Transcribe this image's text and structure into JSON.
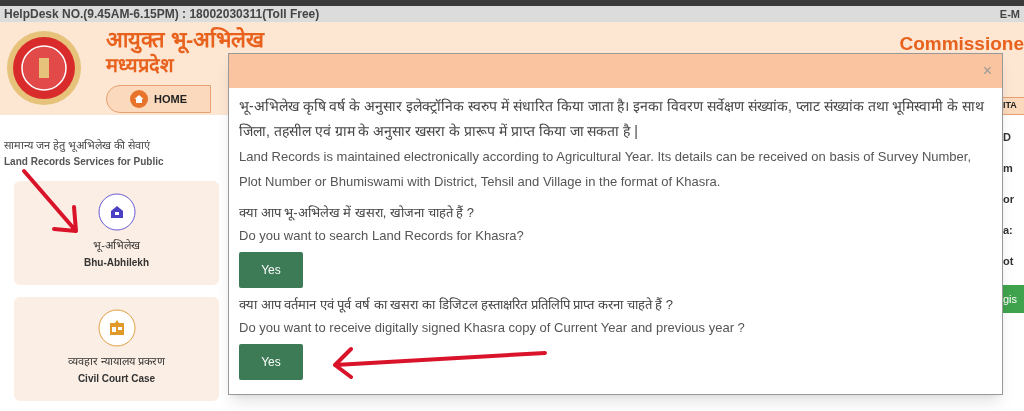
{
  "top_bar": {
    "helpdesk": "HelpDesk NO.(9.45AM-6.15PM) : 18002030311(Toll Free)",
    "email_label": "E-M"
  },
  "header": {
    "title_line_1": "आयुक्त भू-अभिलेख",
    "title_line_2": "मध्यप्रदेश",
    "title_english": "Commissione"
  },
  "nav": {
    "items": [
      {
        "label": "HOME",
        "kind": "home"
      },
      {
        "label": "ITA",
        "kind": "plain"
      }
    ]
  },
  "services": {
    "heading_hindi": "सामान्य जन हेतु भूअभिलेख की सेवाएं",
    "heading_english": "Land Records Services for Public",
    "cards": [
      {
        "title_hindi": "भू-अभिलेख",
        "title_english": "Bhu-Abhilekh",
        "kind": "house"
      },
      {
        "title_hindi": "व्यवहार न्यायालय प्रकरण",
        "title_english": "Civil Court Case",
        "kind": "court"
      }
    ]
  },
  "right_panel": {
    "fragments": [
      "D",
      "m",
      "or",
      "a:",
      "ot"
    ],
    "button": "gis"
  },
  "modal": {
    "close": "×",
    "intro_hindi": "भू-अभिलेख कृषि वर्ष के अनुसार इलेक्ट्रॉनिक स्वरुप में संधारित किया जाता है। इनका विवरण सर्वेक्षण संख्यांक, प्लाट संख्यांक तथा भूमिस्वामी के साथ जिला, तहसील एवं ग्राम के अनुसार खसरा के प्रारूप में प्राप्त किया जा सकता है |",
    "intro_english": "Land Records is maintained electronically according to Agricultural Year. Its details can be received on basis of Survey Number, Plot Number or Bhumiswami with District, Tehsil and Village in the format of Khasra.",
    "questions": [
      {
        "hindi": "क्या आप भू-अभिलेख में खसरा, खोजना चाहते हैं ?",
        "english": "Do you want to search Land Records for Khasra?",
        "button": "Yes"
      },
      {
        "hindi": "क्या आप वर्तमान एवं पूर्व वर्ष का खसरा का डिजिटल हस्ताक्षरित प्रतिलिपि प्राप्त करना चाहते हैं ?",
        "english": "Do you want to receive digitally signed Khasra copy of Current Year and previous year ?",
        "button": "Yes"
      }
    ]
  }
}
